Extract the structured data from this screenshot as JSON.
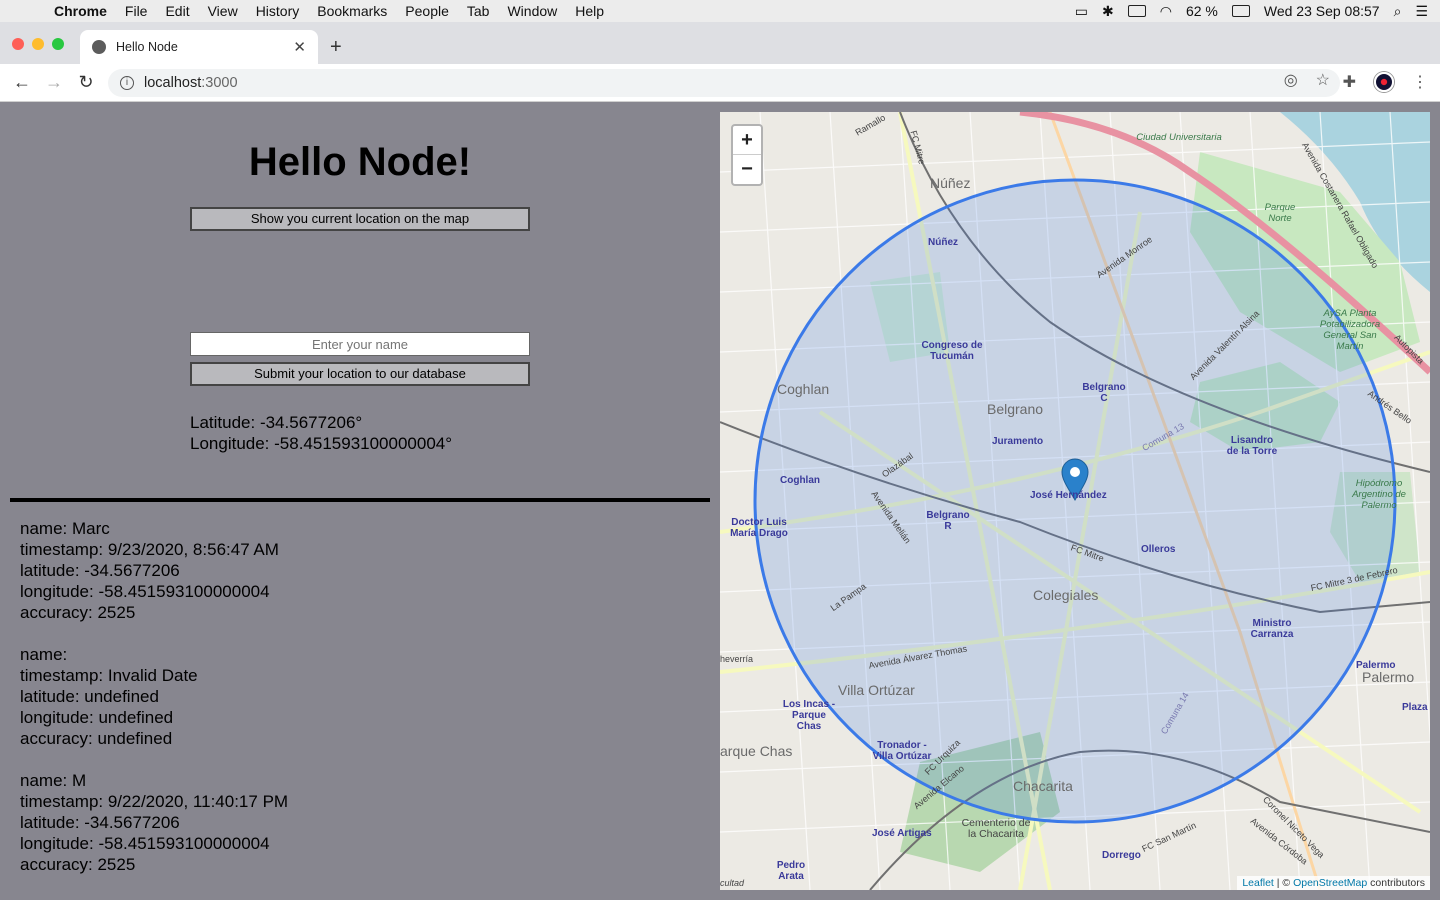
{
  "menubar": {
    "app": "Chrome",
    "items": [
      "File",
      "Edit",
      "View",
      "History",
      "Bookmarks",
      "People",
      "Tab",
      "Window",
      "Help"
    ],
    "battery": "62 %",
    "clock": "Wed 23 Sep  08:57"
  },
  "browser": {
    "tab_title": "Hello Node",
    "url_host": "localhost",
    "url_port": ":3000"
  },
  "page": {
    "heading": "Hello Node!",
    "show_location_button": "Show you current location on the map",
    "name_placeholder": "Enter your name",
    "submit_button": "Submit your location to our database",
    "latitude_line": "Latitude: -34.5677206°",
    "longitude_line": "Longitude: -58.451593100000004°"
  },
  "records": [
    {
      "name": "name: Marc",
      "timestamp": "timestamp: 9/23/2020, 8:56:47 AM",
      "latitude": "latitude: -34.5677206",
      "longitude": "longitude: -58.451593100000004",
      "accuracy": "accuracy: 2525"
    },
    {
      "name": "name:",
      "timestamp": "timestamp: Invalid Date",
      "latitude": "latitude: undefined",
      "longitude": "longitude: undefined",
      "accuracy": "accuracy: undefined"
    },
    {
      "name": "name: M",
      "timestamp": "timestamp: 9/22/2020, 11:40:17 PM",
      "latitude": "latitude: -34.5677206",
      "longitude": "longitude: -58.451593100000004",
      "accuracy": "accuracy: 2525"
    }
  ],
  "map": {
    "zoom_in": "+",
    "zoom_out": "−",
    "attribution_leaflet": "Leaflet",
    "attribution_sep": " | © ",
    "attribution_osm": "OpenStreetMap",
    "attribution_tail": " contributors",
    "circle_color": "#3b7ae8",
    "labels": {
      "nunez_big": "Núñez",
      "nunez": "Núñez",
      "coghlan_big": "Coghlan",
      "coghlan": "Coghlan",
      "belgrano_big": "Belgrano",
      "juramento": "Juramento",
      "congreso": "Congreso de Tucumán",
      "belgrano_c": "Belgrano C",
      "jose_hernandez": "José Hernández",
      "belgrano_r": "Belgrano R",
      "olleros": "Olleros",
      "colegiales_big": "Colegiales",
      "villa_ortuzar_big": "Villa Ortúzar",
      "chacarita_big": "Chacarita",
      "ministro_carranza": "Ministro Carranza",
      "lisandro": "Lisandro de la Torre",
      "palermo_big": "Palermo",
      "palermo": "Palermo",
      "plaza": "Plaza",
      "dorrego": "Dorrego",
      "jose_artigas": "José Artigas",
      "pedro_arata": "Pedro Arata",
      "los_incas": "Los Incas - Parque Chas",
      "tronador": "Tronador - Villa Ortúzar",
      "doctor_drago": "Doctor Luis María Drago",
      "ciudad_universitaria": "Ciudad Universitaria",
      "parque_norte": "Parque Norte",
      "planta": "AySA Planta Potabilizadora General San Martín",
      "hipodromo": "Hipódromo Argentino de Palermo",
      "cementerio": "Cementerio de la Chacarita",
      "parque_chas_big": "arque Chas",
      "avenida_monroe": "Avenida Monroe",
      "avenida_alsina": "Avenida Valentín Alsina",
      "avenida_alvarez": "Avenida Álvarez Thomas",
      "la_pampa": "La Pampa",
      "olazabal": "Olazábal",
      "ramallo": "Ramallo",
      "av_costanera": "Avenida Costanera Rafael Obligado",
      "comuna_13": "Comuna 13",
      "comuna_14": "Comuna 14",
      "fc_mitre": "FC Mitre",
      "fc_mitre_febrero": "FC Mitre  3 de Febrero",
      "andres_bello": "Andrés Bello",
      "villa_ortuzar_small": "heverría",
      "cultad": "cultad",
      "coronel": "Coronel Niceto Vega",
      "avenida_cordoba": "Avenida Córdoba",
      "fc_san_martin": "FC San Martín",
      "fc_urquiza": "FC Urquiza",
      "avenida_elcano": "Avenida Elcano",
      "autopista": "Autopista",
      "avenida_melian": "Avenida Melián",
      "fc_mitre_top": "FC Mitre"
    }
  }
}
